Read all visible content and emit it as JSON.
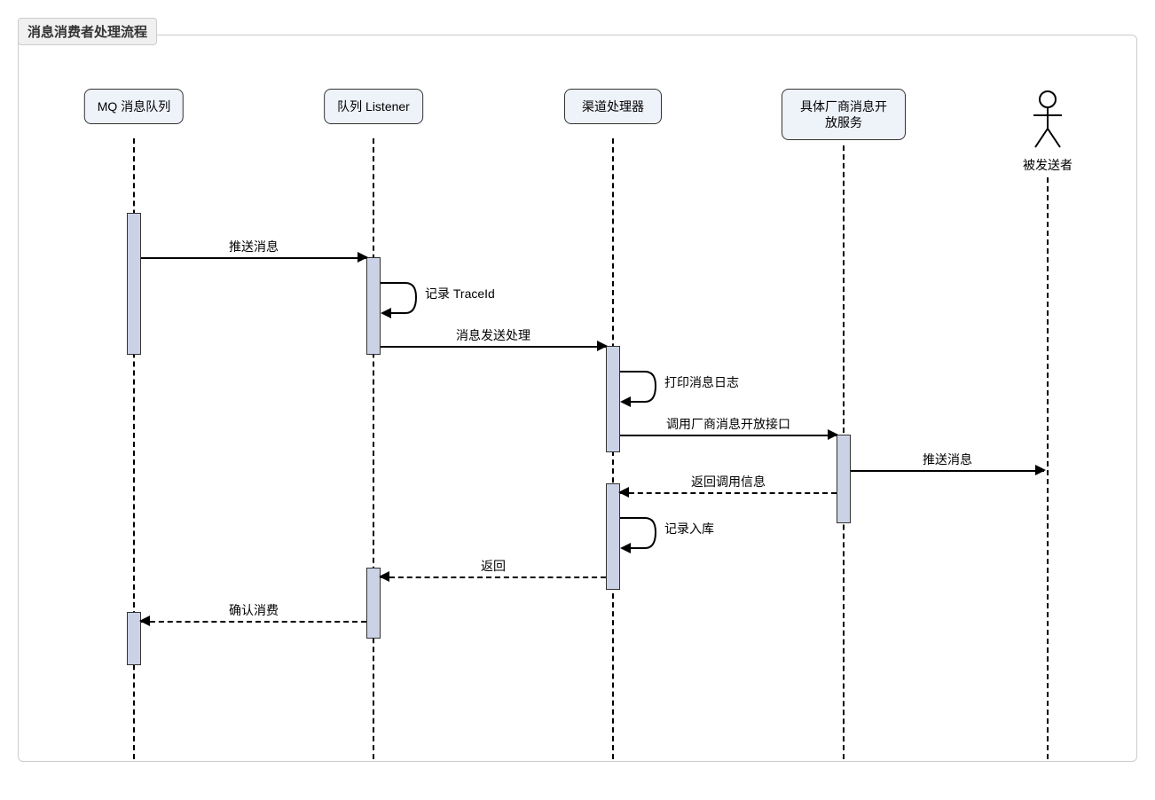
{
  "frame_title": "消息消费者处理流程",
  "participants": {
    "mq": "MQ 消息队列",
    "listener": "队列 Listener",
    "handler": "渠道处理器",
    "vendor": "具体厂商消息开放服务",
    "recipient": "被发送者"
  },
  "messages": {
    "push_msg_1": "推送消息",
    "record_traceid": "记录 TraceId",
    "msg_send_process": "消息发送处理",
    "print_log": "打印消息日志",
    "call_vendor_api": "调用厂商消息开放接口",
    "push_msg_2": "推送消息",
    "return_call_info": "返回调用信息",
    "record_db": "记录入库",
    "return": "返回",
    "ack_consume": "确认消费"
  },
  "chart_data": {
    "type": "sequence_diagram",
    "title": "消息消费者处理流程",
    "participants": [
      {
        "id": "mq",
        "name": "MQ 消息队列",
        "kind": "participant"
      },
      {
        "id": "listener",
        "name": "队列 Listener",
        "kind": "participant"
      },
      {
        "id": "handler",
        "name": "渠道处理器",
        "kind": "participant"
      },
      {
        "id": "vendor",
        "name": "具体厂商消息开放服务",
        "kind": "participant"
      },
      {
        "id": "recipient",
        "name": "被发送者",
        "kind": "actor"
      }
    ],
    "interactions": [
      {
        "from": "mq",
        "to": "listener",
        "label": "推送消息",
        "style": "solid"
      },
      {
        "from": "listener",
        "to": "listener",
        "label": "记录 TraceId",
        "style": "solid"
      },
      {
        "from": "listener",
        "to": "handler",
        "label": "消息发送处理",
        "style": "solid"
      },
      {
        "from": "handler",
        "to": "handler",
        "label": "打印消息日志",
        "style": "solid"
      },
      {
        "from": "handler",
        "to": "vendor",
        "label": "调用厂商消息开放接口",
        "style": "solid"
      },
      {
        "from": "vendor",
        "to": "recipient",
        "label": "推送消息",
        "style": "solid"
      },
      {
        "from": "vendor",
        "to": "handler",
        "label": "返回调用信息",
        "style": "dashed"
      },
      {
        "from": "handler",
        "to": "handler",
        "label": "记录入库",
        "style": "solid"
      },
      {
        "from": "handler",
        "to": "listener",
        "label": "返回",
        "style": "dashed"
      },
      {
        "from": "listener",
        "to": "mq",
        "label": "确认消费",
        "style": "dashed"
      }
    ]
  }
}
